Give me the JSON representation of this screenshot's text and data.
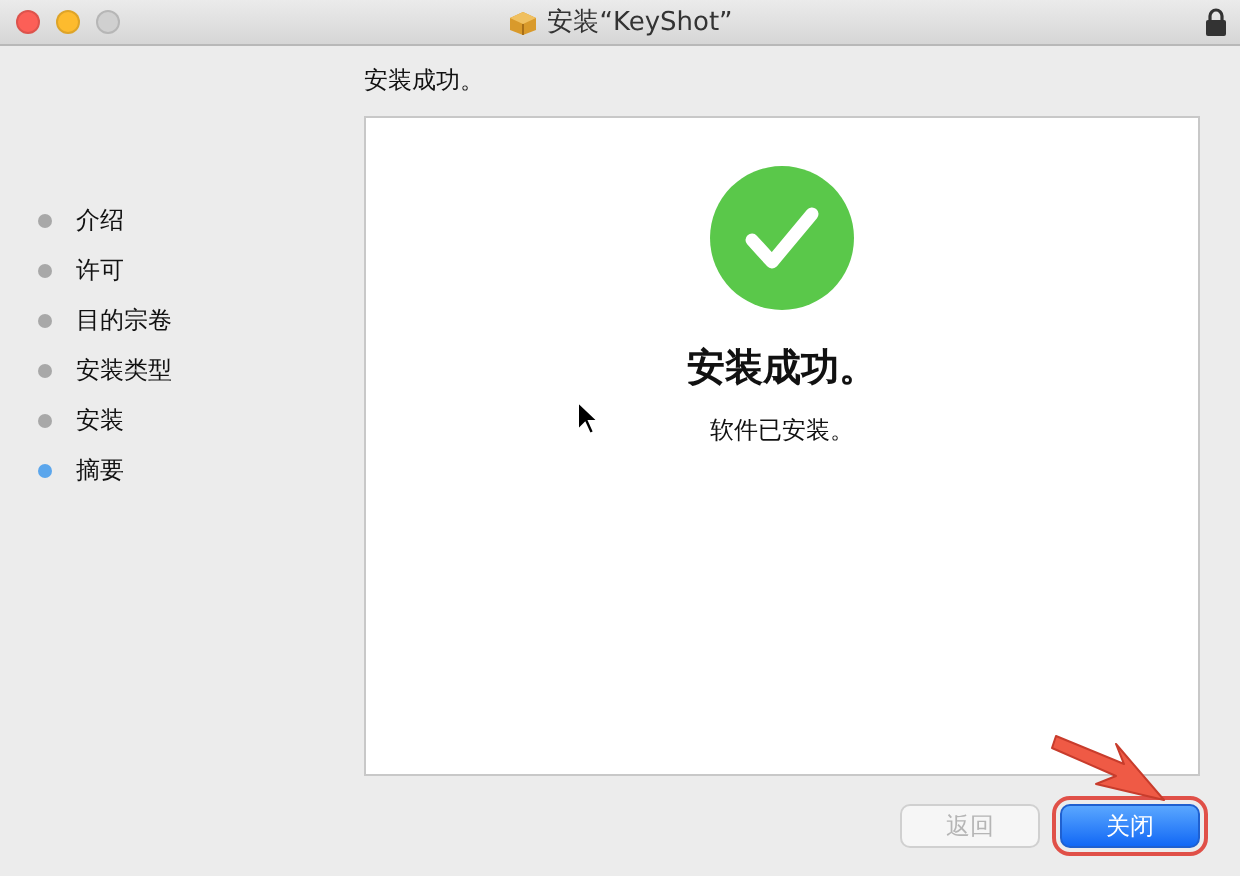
{
  "window": {
    "title": "安装“KeyShot”",
    "locked": true
  },
  "steps": [
    {
      "label": "介绍",
      "selected": false
    },
    {
      "label": "许可",
      "selected": false
    },
    {
      "label": "目的宗卷",
      "selected": false
    },
    {
      "label": "安装类型",
      "selected": false
    },
    {
      "label": "安装",
      "selected": false
    },
    {
      "label": "摘要",
      "selected": true
    }
  ],
  "header": "安装成功。",
  "result": {
    "heading": "安装成功。",
    "message": "软件已安装。"
  },
  "buttons": [
    {
      "label": "返回",
      "disabled": true,
      "highlighted": false
    },
    {
      "label": "关闭",
      "disabled": false,
      "highlighted": true
    }
  ]
}
